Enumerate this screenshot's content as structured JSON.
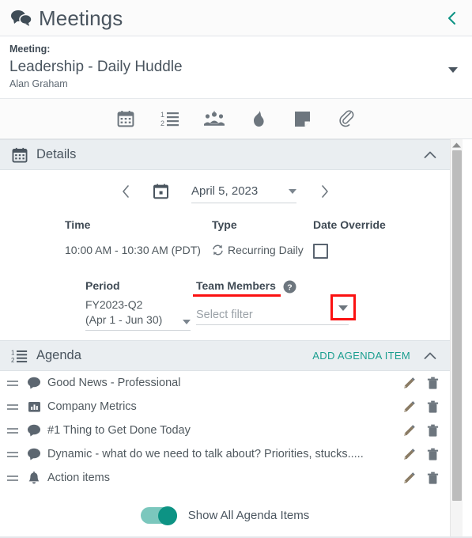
{
  "header": {
    "title": "Meetings",
    "icon": "chat-bubbles-icon",
    "back_icon": "chevron-left-icon"
  },
  "meeting": {
    "label": "Meeting:",
    "title": "Leadership - Daily Huddle",
    "owner": "Alan Graham",
    "caret_icon": "caret-down-icon"
  },
  "toolbar": {
    "items": [
      {
        "name": "calendar-icon",
        "title": "Calendar"
      },
      {
        "name": "numbered-list-icon",
        "title": "Agenda"
      },
      {
        "name": "people-group-icon",
        "title": "Attendees"
      },
      {
        "name": "flame-icon",
        "title": "Issues"
      },
      {
        "name": "note-icon",
        "title": "Notes"
      },
      {
        "name": "paperclip-icon",
        "title": "Attachments"
      }
    ]
  },
  "details": {
    "section_title": "Details",
    "section_icon": "calendar-icon",
    "collapse_icon": "chevron-up-icon",
    "date_nav": {
      "prev_icon": "chevron-left-icon",
      "next_icon": "chevron-right-icon",
      "calendar_icon": "calendar-picker-icon",
      "value": "April 5, 2023"
    },
    "fields": {
      "time_label": "Time",
      "time_value": "10:00 AM - 10:30 AM (PDT)",
      "type_label": "Type",
      "type_value": "Recurring Daily",
      "type_icon": "recurring-icon",
      "date_override_label": "Date Override",
      "date_override_checked": false
    },
    "period": {
      "label": "Period",
      "value_line1": "FY2023-Q2",
      "value_line2": "(Apr 1 - Jun 30)"
    },
    "team_members": {
      "label": "Team Members",
      "help_icon": "help-circle-icon",
      "placeholder": "Select filter",
      "value": "",
      "dropdown_icon": "caret-down-icon",
      "highlight_color": "#fb1111"
    }
  },
  "agenda": {
    "section_title": "Agenda",
    "section_icon": "numbered-list-icon",
    "add_label": "ADD AGENDA ITEM",
    "collapse_icon": "chevron-up-icon",
    "accent_color": "#1a9e8f",
    "items": [
      {
        "text": "Good News - Professional",
        "icon": "speech-bubble-icon"
      },
      {
        "text": "Company Metrics",
        "icon": "bar-chart-icon"
      },
      {
        "text": "#1 Thing to Get Done Today",
        "icon": "speech-bubble-icon"
      },
      {
        "text": "Dynamic - what do we need to talk about? Priorities, stucks.....",
        "icon": "speech-bubble-icon"
      },
      {
        "text": "Action items",
        "icon": "bell-icon"
      }
    ],
    "row_actions": {
      "edit_icon": "pencil-icon",
      "delete_icon": "trash-icon"
    },
    "toggle": {
      "label": "Show All Agenda Items",
      "on": true
    }
  },
  "scrollbar": {
    "up_arrow_icon": "caret-up-icon"
  }
}
